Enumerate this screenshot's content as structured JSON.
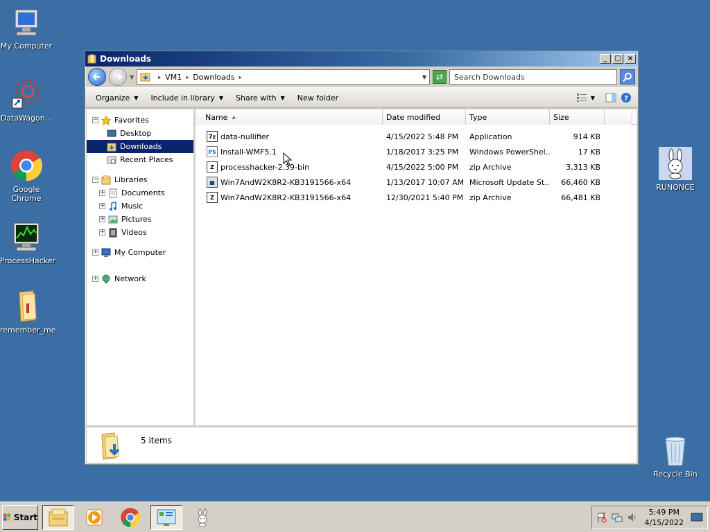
{
  "desktop": {
    "icons": [
      {
        "label": "My Computer"
      },
      {
        "label": "DataWagon..."
      },
      {
        "label": "Google Chrome"
      },
      {
        "label": "ProcessHacker"
      },
      {
        "label": "remember_me"
      },
      {
        "label": "RUNONCE"
      },
      {
        "label": "Recycle Bin"
      }
    ]
  },
  "window": {
    "title": "Downloads",
    "buttons": {
      "minimize": "_",
      "maximize": "□",
      "close": "×"
    },
    "address": {
      "segments": [
        "VM1",
        "Downloads"
      ]
    },
    "search": {
      "placeholder": "Search Downloads"
    },
    "commands": [
      {
        "label": "Organize",
        "dropdown": true
      },
      {
        "label": "Include in library",
        "dropdown": true
      },
      {
        "label": "Share with",
        "dropdown": true
      },
      {
        "label": "New folder",
        "dropdown": false
      }
    ],
    "nav": {
      "favorites": "Favorites",
      "desktop": "Desktop",
      "downloads": "Downloads",
      "recent": "Recent Places",
      "libraries": "Libraries",
      "documents": "Documents",
      "music": "Music",
      "pictures": "Pictures",
      "videos": "Videos",
      "mycomputer": "My Computer",
      "network": "Network"
    },
    "columns": {
      "name": "Name",
      "date": "Date modified",
      "type": "Type",
      "size": "Size"
    },
    "files": [
      {
        "name": "data-nullifier",
        "date": "4/15/2022 5:48 PM",
        "type": "Application",
        "size": "914 KB",
        "icon": "7z-icon"
      },
      {
        "name": "Install-WMF5.1",
        "date": "1/18/2017 3:25 PM",
        "type": "Windows PowerShel...",
        "size": "17 KB",
        "icon": "powershell-icon"
      },
      {
        "name": "processhacker-2.39-bin",
        "date": "4/15/2022 5:00 PM",
        "type": "zip Archive",
        "size": "3,313 KB",
        "icon": "zip-icon"
      },
      {
        "name": "Win7AndW2K8R2-KB3191566-x64",
        "date": "1/13/2017 10:07 AM",
        "type": "Microsoft Update St...",
        "size": "66,460 KB",
        "icon": "msu-icon"
      },
      {
        "name": "Win7AndW2K8R2-KB3191566-x64",
        "date": "12/30/2021 5:40 PM",
        "type": "zip Archive",
        "size": "66,481 KB",
        "icon": "zip-icon"
      }
    ],
    "details": {
      "count": "5 items"
    }
  },
  "taskbar": {
    "start": "Start",
    "clock": {
      "time": "5:49 PM",
      "date": "4/15/2022"
    }
  }
}
